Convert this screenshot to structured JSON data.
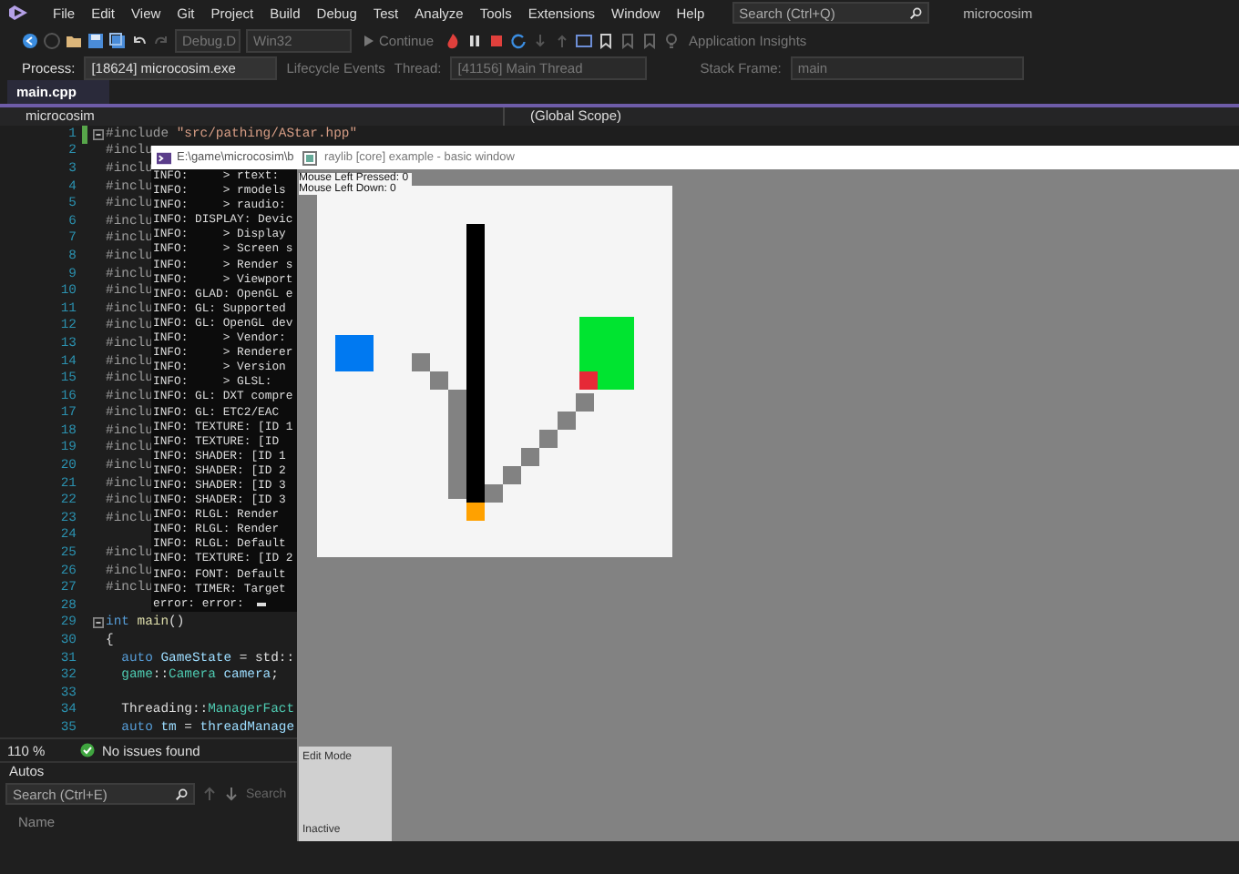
{
  "menubar": {
    "items": [
      "File",
      "Edit",
      "View",
      "Git",
      "Project",
      "Build",
      "Debug",
      "Test",
      "Analyze",
      "Tools",
      "Extensions",
      "Window",
      "Help"
    ],
    "search": {
      "placeholder": "Search (Ctrl+Q)"
    },
    "solution_name": "microcosim"
  },
  "toolbar": {
    "configuration": "Debug.D",
    "platform": "Win32",
    "continue_button": "Continue",
    "insights": "Application Insights"
  },
  "debug_location": {
    "process_label": "Process:",
    "process": "[18624] microcosim.exe",
    "lifecycle": "Lifecycle Events",
    "thread_label": "Thread:",
    "thread": "[41156] Main Thread",
    "stack_label": "Stack Frame:",
    "stack_frame": "main"
  },
  "tabs": [
    {
      "label": "main.cpp",
      "selected": true
    }
  ],
  "navigation": {
    "project": "microcosim",
    "scope": "(Global Scope)"
  },
  "editor": {
    "lines": [
      {
        "number": "1",
        "changed": true,
        "fold": true,
        "tokens": [
          {
            "kind": "directive",
            "text": "#include "
          },
          {
            "kind": "string",
            "text": "\"src/pathing/AStar.hpp\""
          }
        ]
      },
      {
        "number": "2",
        "tokens": [
          {
            "kind": "directive",
            "text": "#inclu"
          }
        ]
      },
      {
        "number": "3",
        "tokens": [
          {
            "kind": "directive",
            "text": "#inclu"
          }
        ]
      },
      {
        "number": "4",
        "tokens": [
          {
            "kind": "directive",
            "text": "#inclu"
          }
        ]
      },
      {
        "number": "5",
        "tokens": [
          {
            "kind": "directive",
            "text": "#inclu"
          }
        ]
      },
      {
        "number": "6",
        "tokens": [
          {
            "kind": "directive",
            "text": "#inclu"
          }
        ]
      },
      {
        "number": "7",
        "tokens": [
          {
            "kind": "directive",
            "text": "#inclu"
          }
        ]
      },
      {
        "number": "8",
        "tokens": [
          {
            "kind": "directive",
            "text": "#inclu"
          }
        ]
      },
      {
        "number": "9",
        "tokens": [
          {
            "kind": "directive",
            "text": "#inclu"
          }
        ]
      },
      {
        "number": "10",
        "tokens": [
          {
            "kind": "directive",
            "text": "#inclu"
          }
        ]
      },
      {
        "number": "11",
        "tokens": [
          {
            "kind": "directive",
            "text": "#inclu"
          }
        ]
      },
      {
        "number": "12",
        "tokens": [
          {
            "kind": "directive",
            "text": "#inclu"
          }
        ]
      },
      {
        "number": "13",
        "tokens": [
          {
            "kind": "directive",
            "text": "#inclu"
          }
        ]
      },
      {
        "number": "14",
        "tokens": [
          {
            "kind": "directive",
            "text": "#inclu"
          }
        ]
      },
      {
        "number": "15",
        "tokens": [
          {
            "kind": "directive",
            "text": "#inclu"
          }
        ]
      },
      {
        "number": "16",
        "tokens": [
          {
            "kind": "directive",
            "text": "#inclu"
          }
        ]
      },
      {
        "number": "17",
        "tokens": [
          {
            "kind": "directive",
            "text": "#inclu"
          }
        ]
      },
      {
        "number": "18",
        "tokens": [
          {
            "kind": "directive",
            "text": "#inclu"
          }
        ]
      },
      {
        "number": "19",
        "tokens": [
          {
            "kind": "directive",
            "text": "#inclu"
          }
        ]
      },
      {
        "number": "20",
        "tokens": [
          {
            "kind": "directive",
            "text": "#inclu"
          }
        ]
      },
      {
        "number": "21",
        "tokens": [
          {
            "kind": "directive",
            "text": "#inclu"
          }
        ]
      },
      {
        "number": "22",
        "tokens": [
          {
            "kind": "directive",
            "text": "#inclu"
          }
        ]
      },
      {
        "number": "23",
        "tokens": [
          {
            "kind": "directive",
            "text": "#inclu"
          }
        ]
      },
      {
        "number": "24"
      },
      {
        "number": "25",
        "tokens": [
          {
            "kind": "directive",
            "text": "#inclu"
          }
        ]
      },
      {
        "number": "26",
        "tokens": [
          {
            "kind": "directive",
            "text": "#inclu"
          }
        ]
      },
      {
        "number": "27",
        "tokens": [
          {
            "kind": "directive",
            "text": "#inclu"
          }
        ]
      },
      {
        "number": "28"
      },
      {
        "number": "29",
        "fold": true,
        "tokens": [
          {
            "kind": "keyword",
            "text": "int"
          },
          {
            "kind": "function",
            "text": " main"
          },
          {
            "kind": "plain",
            "text": "()"
          }
        ]
      },
      {
        "number": "30",
        "tokens": [
          {
            "kind": "plain",
            "text": "{"
          }
        ]
      },
      {
        "number": "31",
        "tokens": [
          {
            "kind": "keyword",
            "text": "  auto"
          },
          {
            "kind": "variable",
            "text": " GameState"
          },
          {
            "kind": "plain",
            "text": " = std::"
          }
        ]
      },
      {
        "number": "32",
        "tokens": [
          {
            "kind": "type",
            "text": "  game"
          },
          {
            "kind": "plain",
            "text": "::"
          },
          {
            "kind": "type",
            "text": "Camera"
          },
          {
            "kind": "variable",
            "text": " camera"
          },
          {
            "kind": "plain",
            "text": ";"
          }
        ]
      },
      {
        "number": "33"
      },
      {
        "number": "34",
        "tokens": [
          {
            "kind": "plain",
            "text": "  Threading::"
          },
          {
            "kind": "type",
            "text": "ManagerFact"
          }
        ]
      },
      {
        "number": "35",
        "tokens": [
          {
            "kind": "keyword",
            "text": "  auto"
          },
          {
            "kind": "variable",
            "text": " tm"
          },
          {
            "kind": "plain",
            "text": " = "
          },
          {
            "kind": "variable",
            "text": "threadManage"
          }
        ]
      }
    ]
  },
  "status": {
    "zoom": "110 %",
    "issues": "No issues found"
  },
  "autos": {
    "title": "Autos",
    "search": {
      "placeholder": "Search (Ctrl+E)"
    },
    "search_depth": "Search",
    "columns": [
      "Name"
    ]
  },
  "console": {
    "title": "E:\\game\\microcosim\\b",
    "lines": [
      "INFO:     > rtext:",
      "INFO:     > rmodels",
      "INFO:     > raudio:",
      "INFO: DISPLAY: Devic",
      "INFO:     > Display",
      "INFO:     > Screen s",
      "INFO:     > Render s",
      "INFO:     > Viewport",
      "INFO: GLAD: OpenGL e",
      "INFO: GL: Supported",
      "INFO: GL: OpenGL dev",
      "INFO:     > Vendor:",
      "INFO:     > Renderer",
      "INFO:     > Version",
      "INFO:     > GLSL:",
      "INFO: GL: DXT compre",
      "INFO: GL: ETC2/EAC",
      "INFO: TEXTURE: [ID 1",
      "INFO: TEXTURE: [ID",
      "INFO: SHADER: [ID 1",
      "INFO: SHADER: [ID 2",
      "INFO: SHADER: [ID 3",
      "INFO: SHADER: [ID 3",
      "INFO: RLGL: Render",
      "INFO: RLGL: Render",
      "INFO: RLGL: Default",
      "INFO: TEXTURE: [ID 2",
      "INFO: FONT: Default",
      "INFO: TIMER: Target",
      "error: error:"
    ]
  },
  "game_window": {
    "title": "raylib [core] example - basic window",
    "overlay": [
      "Mouse Left Pressed: 0",
      "Mouse Left Down: 0"
    ],
    "panel": {
      "mode": "Edit Mode",
      "state": "Inactive"
    }
  }
}
